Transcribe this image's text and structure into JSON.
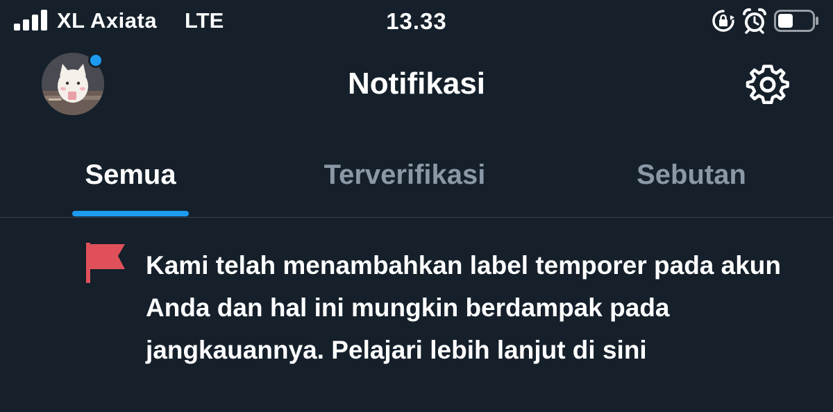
{
  "status_bar": {
    "carrier": "XL Axiata",
    "network": "LTE",
    "time": "13.33",
    "icons": [
      "signal-icon",
      "rotation-lock-icon",
      "alarm-icon",
      "battery-icon"
    ],
    "battery_level": 0.45
  },
  "header": {
    "title": "Notifikasi",
    "avatar_icon": "avatar",
    "settings_icon": "gear-icon",
    "unread_dot_color": "#1d9bf0"
  },
  "tabs": [
    {
      "label": "Semua",
      "active": true
    },
    {
      "label": "Terverifikasi",
      "active": false
    },
    {
      "label": "Sebutan",
      "active": false
    }
  ],
  "notification": {
    "icon": "flag-icon",
    "icon_color": "#e0505a",
    "text": "Kami telah menambahkan label temporer pada akun Anda dan hal ini mungkin berdampak pada jangkauannya. Pelajari lebih lanjut di sini"
  },
  "colors": {
    "background": "#15202b",
    "accent": "#1d9bf0",
    "inactive_text": "#8b98a5",
    "divider": "#38444d"
  }
}
